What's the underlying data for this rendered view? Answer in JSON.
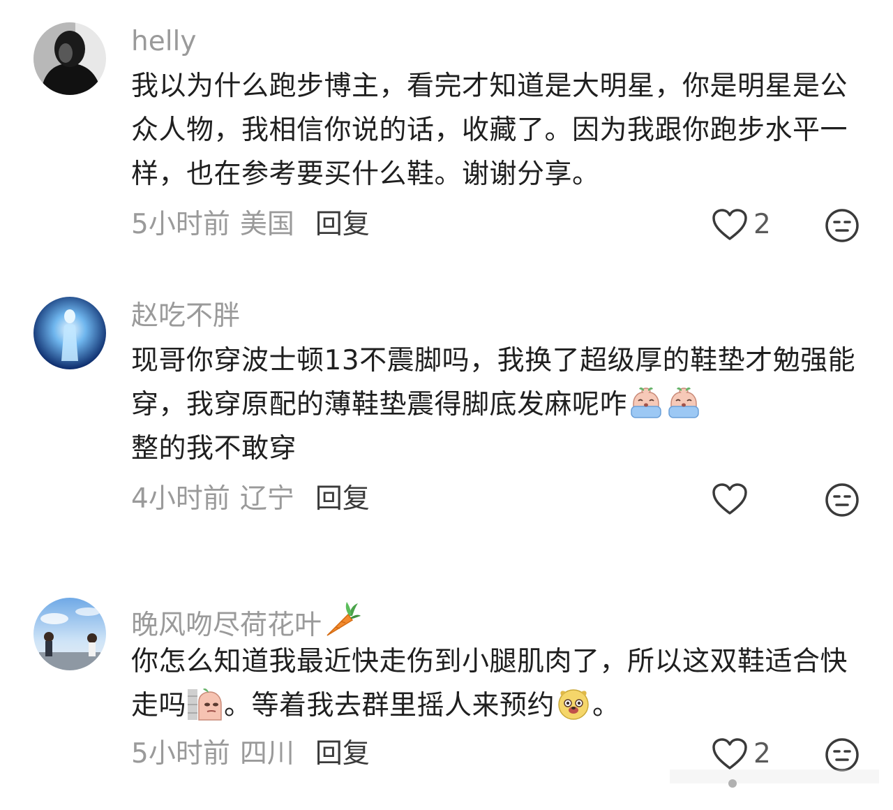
{
  "comments": [
    {
      "username": "helly",
      "text": "我以为什么跑步博主，看完才知道是大明星，你是明星是公众人物，我相信你说的话，收藏了。因为我跟你跑步水平一样，也在参考要买什么鞋。谢谢分享。",
      "time": "5小时前",
      "location": "美国",
      "reply_label": "回复",
      "likes": "2",
      "avatar_icon": "avatar-dark-portrait"
    },
    {
      "username": "赵吃不胖",
      "text_part1": "现哥你穿波士顿13不震脚吗，我换了超级厚的鞋垫才勉强能穿，我穿原配的薄鞋垫震得脚底发麻呢咋",
      "text_part2": "整的我不敢穿",
      "emoji": "crying-peach-emoji",
      "time": "4小时前",
      "location": "辽宁",
      "reply_label": "回复",
      "likes": "",
      "avatar_icon": "avatar-glowing-figure"
    },
    {
      "username": "晚风吻尽荷花叶",
      "username_emoji": "carrot-emoji",
      "text_part1": "你怎么知道我最近快走伤到小腿肌肉了，所以这双鞋适合快走吗",
      "text_part2": "。等着我去群里摇人来预约",
      "text_part3": "。",
      "time": "5小时前",
      "location": "四川",
      "reply_label": "回复",
      "likes": "2",
      "avatar_icon": "avatar-anime-scene"
    }
  ],
  "colors": {
    "secondary_text": "#9a9a9a",
    "primary_text": "#1f1f1f",
    "icon_stroke": "#3a3a3a"
  }
}
